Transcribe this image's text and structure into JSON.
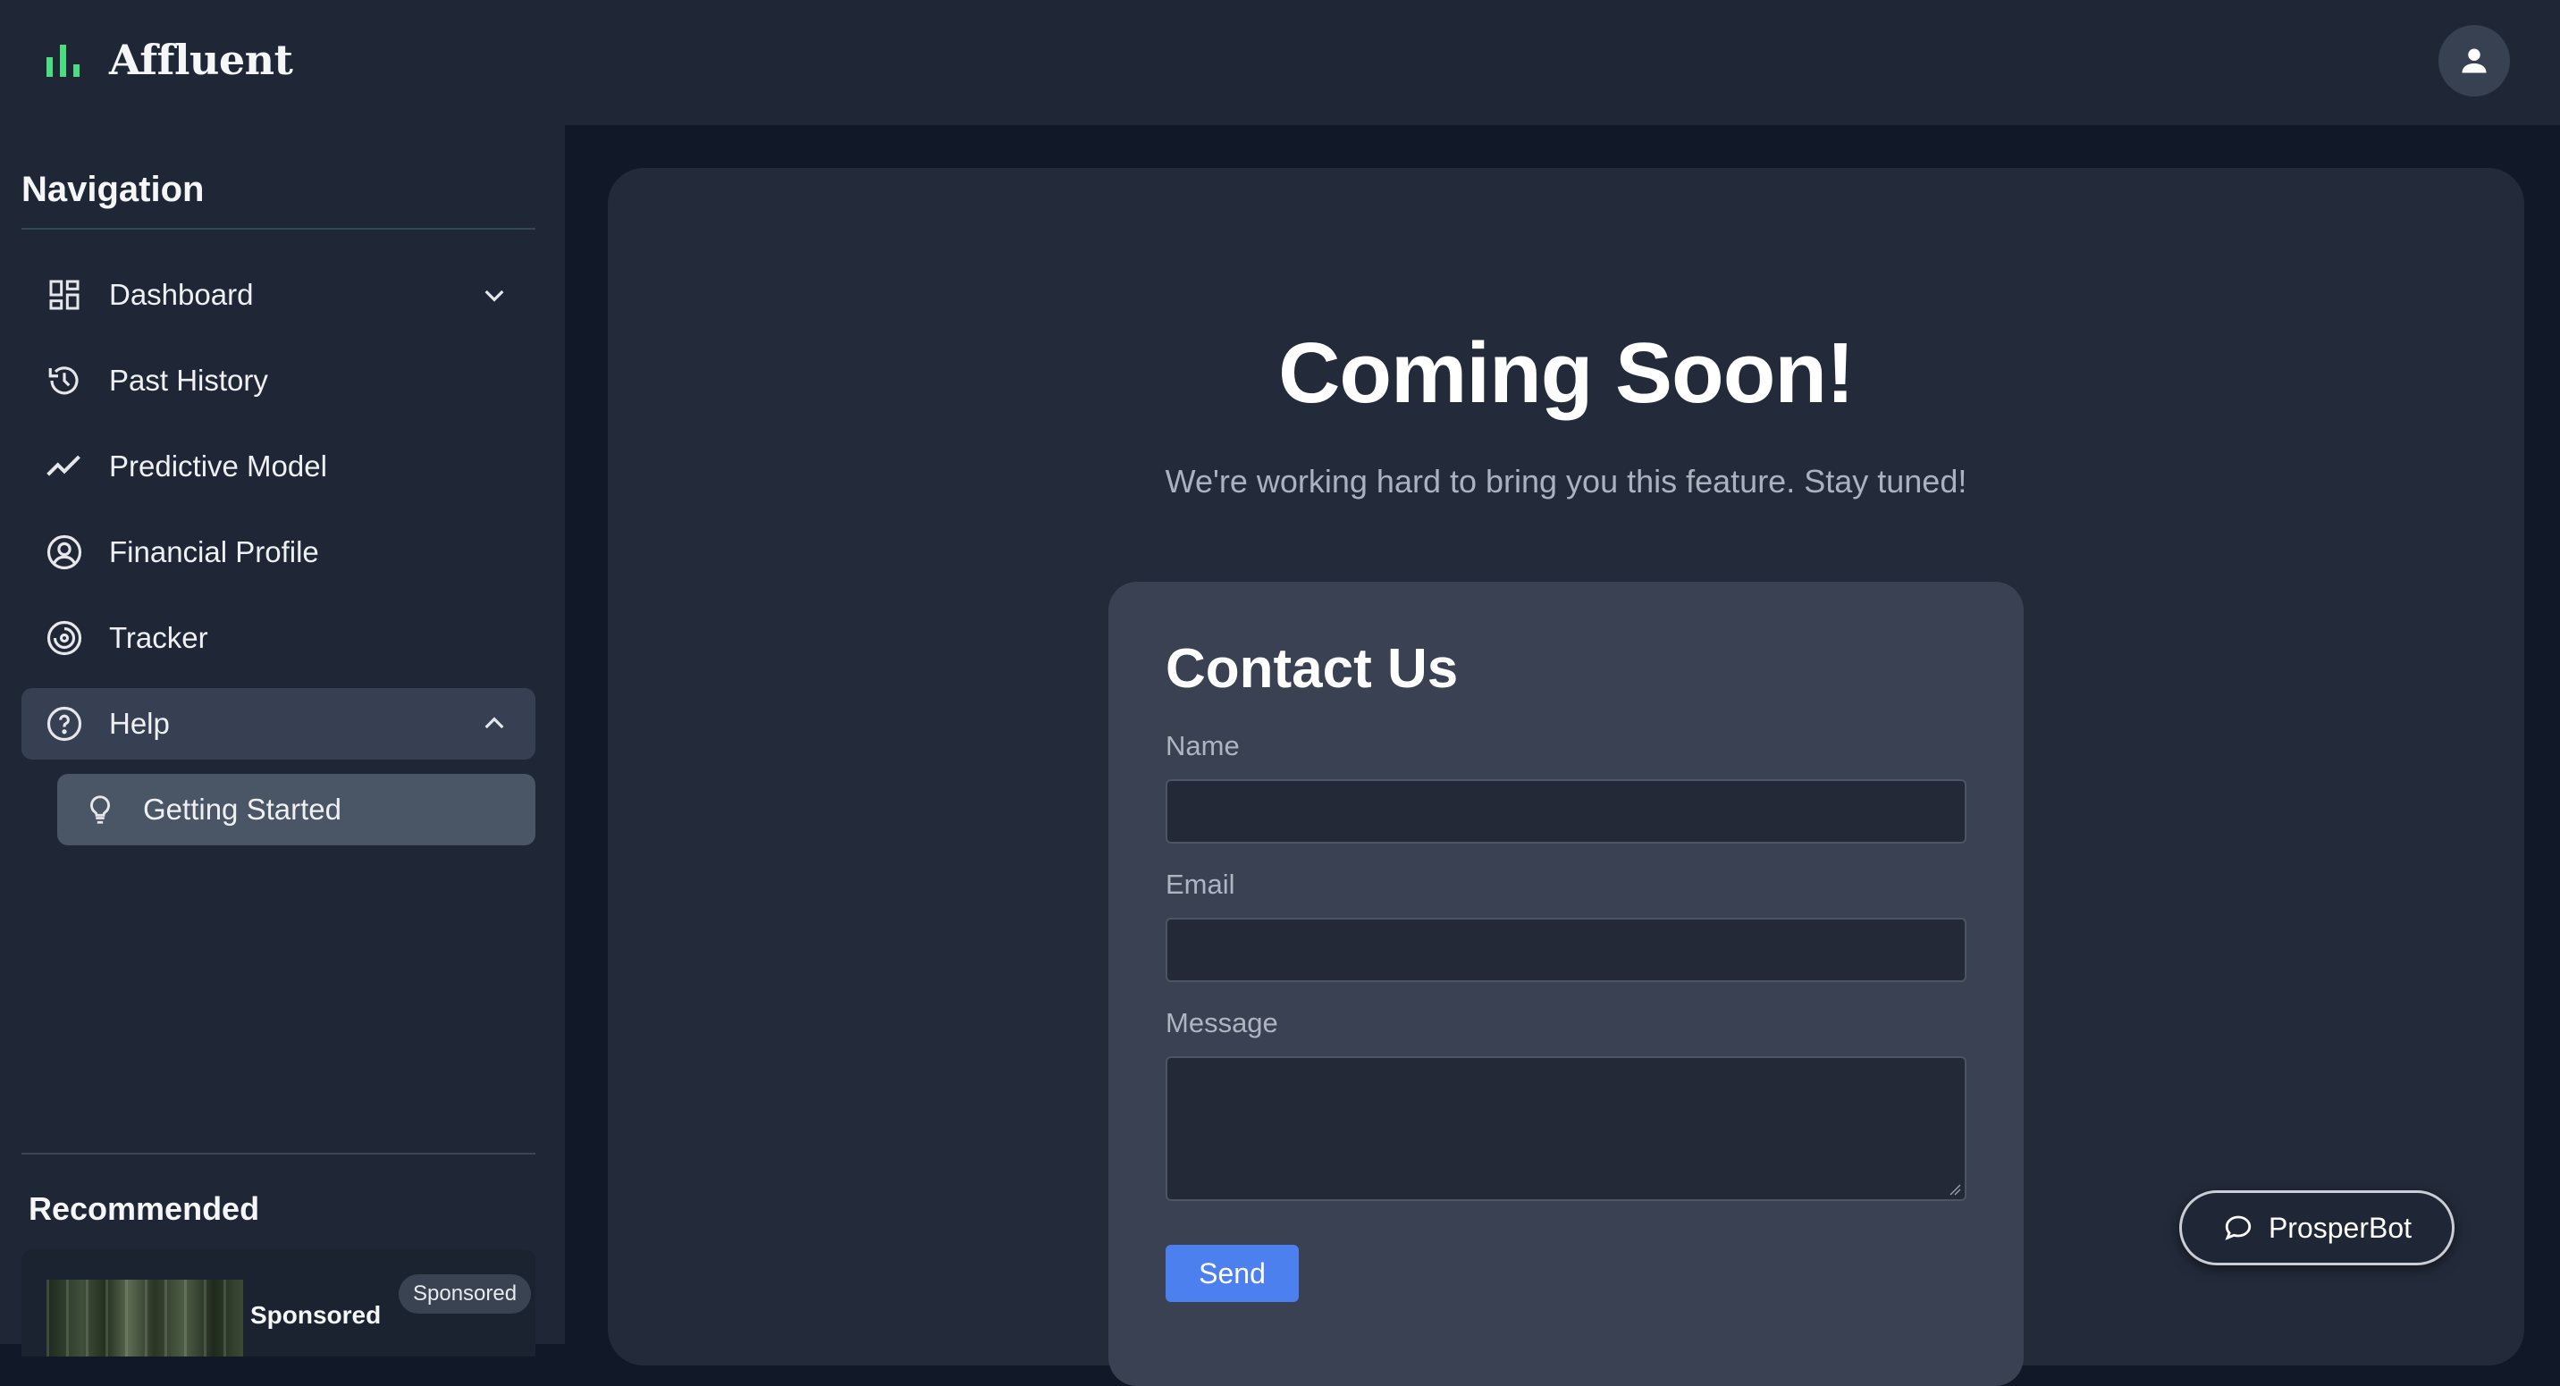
{
  "app": {
    "brand": "Affluent",
    "brand_color": "#4ade80"
  },
  "sidebar": {
    "title": "Navigation",
    "items": [
      {
        "label": "Dashboard",
        "icon": "dashboard-grid-icon",
        "has_chevron": "down"
      },
      {
        "label": "Past History",
        "icon": "history-icon"
      },
      {
        "label": "Predictive Model",
        "icon": "trend-line-icon"
      },
      {
        "label": "Financial Profile",
        "icon": "user-circle-icon"
      },
      {
        "label": "Tracker",
        "icon": "target-icon"
      },
      {
        "label": "Help",
        "icon": "question-circle-icon",
        "has_chevron": "up",
        "active": true
      }
    ],
    "subitems": [
      {
        "label": "Getting Started",
        "icon": "lightbulb-icon",
        "selected": true
      }
    ],
    "recommended": {
      "title": "Recommended",
      "card_name": "Sponsored",
      "badge": "Sponsored"
    }
  },
  "main": {
    "headline": "Coming Soon!",
    "subline": "We're working hard to bring you this feature. Stay tuned!",
    "contact": {
      "title": "Contact Us",
      "name_label": "Name",
      "name_value": "",
      "email_label": "Email",
      "email_value": "",
      "message_label": "Message",
      "message_value": "",
      "send_label": "Send",
      "send_color": "#4c80ee"
    }
  },
  "chatbot": {
    "label": "ProsperBot",
    "icon": "chat-bubble-icon"
  }
}
